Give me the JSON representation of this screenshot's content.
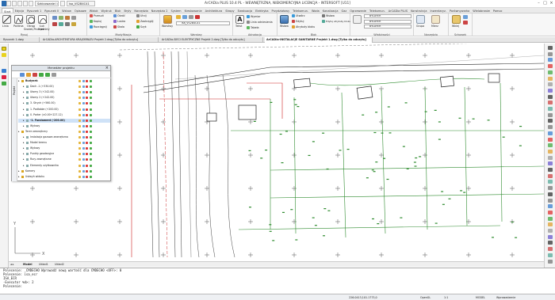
{
  "window": {
    "title": "ArCADia PLUS 10.4 PL - WEWNĘTRZNA, NIEKOMERCYJNA LICENCJA - INTERSOFT [U11]",
    "quick_access_1": "Szkicowanie i opisy",
    "quick_access_2": "isa_VS2B4C41"
  },
  "ribbon_tabs": [
    "Start",
    "Edycja",
    "Rysunek 1",
    "Rysunek II",
    "Wstaw",
    "Opisowe",
    "Widok",
    "Wydruk",
    "Blok",
    "Bryły",
    "Narzędzia",
    "Narzędzia 2",
    "System",
    "Kreskowanie",
    "Architektura",
    "Stropy",
    "Ewakuacja",
    "Elektryka",
    "Przydziałowy",
    "Telekomun.",
    "Woda",
    "Kanalizacja",
    "Gaz",
    "Ogrzewanie",
    "Telekomun.",
    "ArCADia PLUS",
    "Konstrukcja",
    "Inwentaryz.",
    "Porównywarka",
    "Wielobranże",
    "Pomoc"
  ],
  "active_tab_index": 0,
  "ribbon": {
    "groups": [
      "Rysuj",
      "Modyfikacja",
      "Warstwy",
      "Adnotacja",
      "Blok",
      "Właściwości",
      "Narzędzia",
      "Schowek"
    ],
    "draw": [
      "Linia",
      "Polilinia",
      "Okrąg",
      "Łuk"
    ],
    "draw_sub": [
      "Środek,Promień",
      "3 punkty"
    ],
    "modify": [
      "Przesuń",
      "Obróć",
      "Utnij",
      "Kopiuj",
      "Lustro",
      "Zaokrąglij",
      "Rozciągnij",
      "Skala",
      "Szyk"
    ],
    "layers_label": "Warstwy",
    "layer_combo": "isa_VS2B4C41",
    "annot": [
      "Tekst",
      "Wymiar",
      "Linia odniesienia",
      "Tabela"
    ],
    "block": [
      "Wstaw",
      "Utwórz",
      "Edytuj",
      "Atrybuty bloku"
    ],
    "block_extra": [
      "Wstaw",
      "Edytuj atrybuty bloku"
    ],
    "props": [
      "BYLAYER",
      "BYLAYER",
      "BYLAYER"
    ],
    "tools": [
      "Grupa",
      "Mierz"
    ],
    "clip": [
      "Wklej"
    ]
  },
  "doc_tabs": [
    "Rysunek 1.dwg",
    "ArCADia-ARCHITEKTURA KRAJOBRAZU Projekt 2.dwg [Tylko do odczytu]",
    "ArCADia-SIECI ELEKTRYCZNE Projekt 2.dwg [Tylko do odczytu]",
    "ArCADia-INSTALACJE SANITARNE Projekt 1.dwg [Tylko do odczytu]"
  ],
  "active_doc_index": 3,
  "project_panel": {
    "title": "Menedżer projektu",
    "side_label": "Projekt",
    "rows": [
      {
        "label": "Budynek",
        "indent": 0,
        "bold": true,
        "sel": false
      },
      {
        "label": "Dach -1 (+330.00)",
        "indent": 1,
        "bold": false,
        "sel": false
      },
      {
        "label": "Ułomy 3 (+242.00)",
        "indent": 1,
        "bold": false,
        "sel": false
      },
      {
        "label": "Ułomy 2 (+242.00)",
        "indent": 1,
        "bold": false,
        "sel": false
      },
      {
        "label": "3. Strych (+560.00)",
        "indent": 1,
        "bold": false,
        "sel": false
      },
      {
        "label": "1. Podłobże (+200.00)",
        "indent": 1,
        "bold": false,
        "sel": false
      },
      {
        "label": "0. Parter (±0.00+227.12)",
        "indent": 1,
        "bold": false,
        "sel": false
      },
      {
        "label": "-1. Fundament (-200.00)",
        "indent": 1,
        "bold": true,
        "sel": true
      },
      {
        "label": "Wykazy",
        "indent": 1,
        "bold": false,
        "sel": false
      },
      {
        "label": "Teren zewnętrzny",
        "indent": 0,
        "bold": false,
        "sel": false
      },
      {
        "label": "Instalacja gazowa zewnętrzna",
        "indent": 1,
        "bold": false,
        "sel": false
      },
      {
        "label": "Model terenu",
        "indent": 1,
        "bold": false,
        "sel": false
      },
      {
        "label": "Wykazy",
        "indent": 1,
        "bold": false,
        "sel": false
      },
      {
        "label": "Punkty geodezyjne",
        "indent": 1,
        "bold": false,
        "sel": false
      },
      {
        "label": "Rury zewnętrzne",
        "indent": 1,
        "bold": false,
        "sel": false
      },
      {
        "label": "Elementy użytkownika",
        "indent": 1,
        "bold": false,
        "sel": false
      },
      {
        "label": "Kamery",
        "indent": 0,
        "bold": false,
        "sel": false
      },
      {
        "label": "Ustwyń widoku",
        "indent": 0,
        "bold": false,
        "sel": false
      }
    ]
  },
  "layout_tabs": [
    "Model",
    "Układ1",
    "Układ2"
  ],
  "command_lines": [
    "Polecenie: _CMDECHO Wprowadź nową wartość dla CMDECHO <OFF>: 0",
    "Polecenie: isa_ecr",
    "ISA_ECR",
    "-Executor %d>: 2",
    "Polecenie:"
  ],
  "status": {
    "coords": "226.0413,101.1773,0",
    "items": [
      "OpenGL",
      "MODEL",
      "Wprowadzenie"
    ],
    "scale": "1:1"
  },
  "colors": {
    "accent": "#2b6cb0",
    "green_lines": "#2e8b2e",
    "red_lines": "#cc2222"
  }
}
